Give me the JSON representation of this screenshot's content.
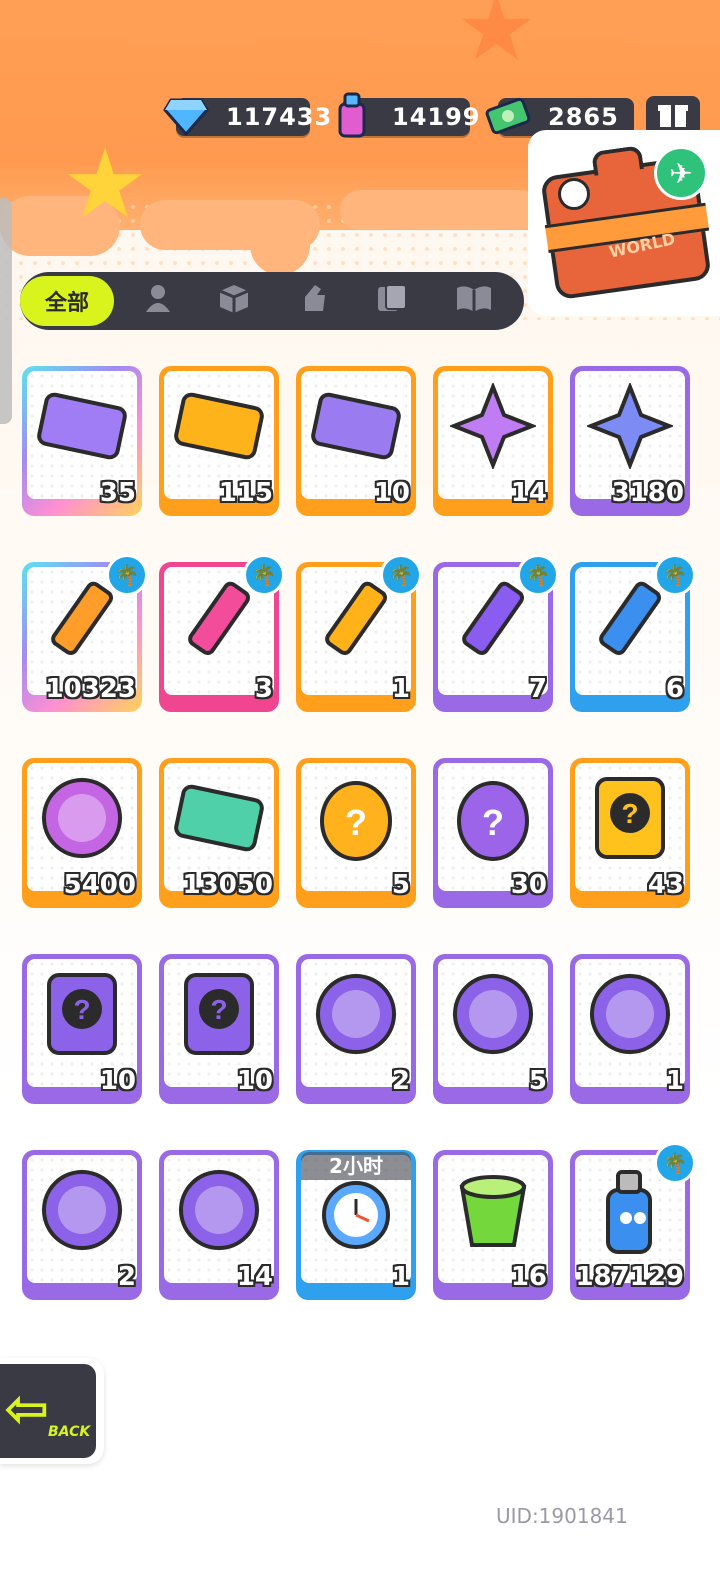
{
  "currencies": {
    "gems": {
      "value": "117433",
      "icon": "diamond-icon",
      "color": "#3ba7ff"
    },
    "paint": {
      "value": "14199",
      "icon": "spray-can-icon",
      "color": "#e05ccf"
    },
    "cash": {
      "value": "2865万",
      "icon": "cash-icon",
      "color": "#3ac26a"
    },
    "gift_icon": "gift-box-icon"
  },
  "world_button": {
    "label": "WORLD"
  },
  "tabs": {
    "active": "全部",
    "icons": [
      "person-icon",
      "box-icon",
      "hand-icon",
      "cards-icon",
      "book-icon"
    ]
  },
  "items": [
    {
      "name": "purple-ticket",
      "count": "35",
      "border": "rainbow"
    },
    {
      "name": "gold-ticket",
      "count": "115",
      "border": "orange"
    },
    {
      "name": "violet-ticket",
      "count": "10",
      "border": "orange"
    },
    {
      "name": "rainbow-star",
      "count": "14",
      "border": "orange"
    },
    {
      "name": "blue-star",
      "count": "3180",
      "border": "purple"
    },
    {
      "name": "rainbow-crayon",
      "count": "10323",
      "border": "rainbow",
      "badge": true
    },
    {
      "name": "pink-crayon",
      "count": "3",
      "border": "pink",
      "badge": true
    },
    {
      "name": "yellow-crayon",
      "count": "1",
      "border": "orange",
      "badge": true
    },
    {
      "name": "purple-crayon",
      "count": "7",
      "border": "purple",
      "badge": true
    },
    {
      "name": "blue-crayon",
      "count": "6",
      "border": "blue",
      "badge": true
    },
    {
      "name": "cool-sticker",
      "count": "5400",
      "border": "orange"
    },
    {
      "name": "season-ticket",
      "count": "13050",
      "border": "orange"
    },
    {
      "name": "gold-mystery-egg",
      "count": "5",
      "border": "orange"
    },
    {
      "name": "purple-mystery-egg",
      "count": "30",
      "border": "purple"
    },
    {
      "name": "gold-deity-card",
      "count": "43",
      "border": "orange"
    },
    {
      "name": "purple-deity-card",
      "count": "10",
      "border": "purple"
    },
    {
      "name": "travel-card",
      "count": "10",
      "border": "purple"
    },
    {
      "name": "mpet-bat",
      "count": "2",
      "border": "purple"
    },
    {
      "name": "mpet-fish",
      "count": "5",
      "border": "purple"
    },
    {
      "name": "mpet-piranha",
      "count": "1",
      "border": "purple"
    },
    {
      "name": "mpet-jelly",
      "count": "2",
      "border": "purple"
    },
    {
      "name": "mpet-sprout",
      "count": "14",
      "border": "purple"
    },
    {
      "name": "alarm-clock",
      "count": "1",
      "border": "blue",
      "timer": "2小时"
    },
    {
      "name": "green-jelly-cup",
      "count": "16",
      "border": "purple"
    },
    {
      "name": "paint-spray",
      "count": "187129",
      "border": "purple",
      "badge": true
    }
  ],
  "back_button": {
    "label": "BACK"
  },
  "uid": "UID:1901841"
}
